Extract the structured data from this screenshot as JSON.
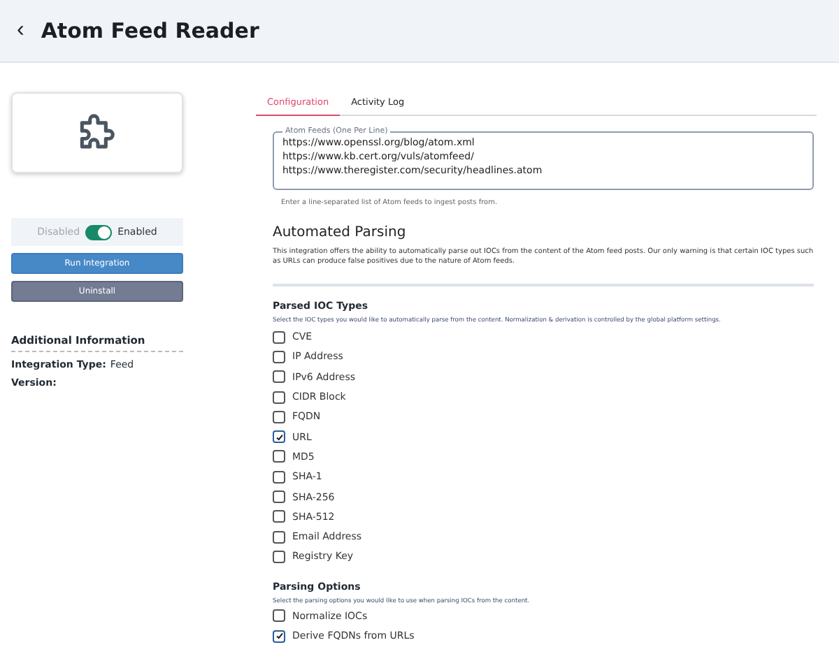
{
  "header": {
    "back": "‹",
    "title": "Atom Feed Reader"
  },
  "toggle": {
    "off_label": "Disabled",
    "on_label": "Enabled",
    "on": true
  },
  "actions": [
    {
      "label": "Run Integration",
      "kind": "primary"
    },
    {
      "label": "Uninstall",
      "kind": "secondary"
    }
  ],
  "info": {
    "title": "Additional Information",
    "rows": [
      {
        "label": "Integration Type:",
        "value": "Feed"
      },
      {
        "label": "Version:",
        "value": ""
      }
    ]
  },
  "tabs": [
    {
      "label": "Configuration",
      "selected": true
    },
    {
      "label": "Activity Log",
      "selected": false
    }
  ],
  "feeds": {
    "label": "Atom Feeds (One Per Line)",
    "value": [
      "https://www.openssl.org/blog/atom.xml",
      "https://www.kb.cert.org/vuls/atomfeed/",
      "https://www.theregister.com/security/headlines.atom"
    ],
    "hint": "Enter a line-separated list of Atom feeds to ingest posts from."
  },
  "parsing": {
    "title": "Automated Parsing",
    "text": "This integration offers the ability to automatically parse out IOCs from the content of the Atom feed posts. Our only warning is that certain IOC types such as URLs can produce false positives due to the nature of Atom feeds."
  },
  "ioc_types": {
    "title": "Parsed IOC Types",
    "text": "Select the IOC types you would like to automatically parse from the content. Normalization & derivation is controlled by the global platform settings.",
    "items": [
      {
        "label": "CVE",
        "checked": false
      },
      {
        "label": "IP Address",
        "checked": false
      },
      {
        "label": "IPv6 Address",
        "checked": false
      },
      {
        "label": "CIDR Block",
        "checked": false
      },
      {
        "label": "FQDN",
        "checked": false
      },
      {
        "label": "URL",
        "checked": true
      },
      {
        "label": "MD5",
        "checked": false
      },
      {
        "label": "SHA-1",
        "checked": false
      },
      {
        "label": "SHA-256",
        "checked": false
      },
      {
        "label": "SHA-512",
        "checked": false
      },
      {
        "label": "Email Address",
        "checked": false
      },
      {
        "label": "Registry Key",
        "checked": false
      }
    ]
  },
  "options": {
    "title": "Parsing Options",
    "text": "Select the parsing options you would like to use when parsing IOCs from the content.",
    "items": [
      {
        "label": "Normalize IOCs",
        "checked": false
      },
      {
        "label": "Derive FQDNs from URLs",
        "checked": true
      }
    ]
  }
}
